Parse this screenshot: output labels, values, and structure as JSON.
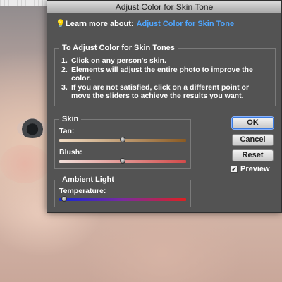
{
  "window": {
    "title": "Adjust Color for Skin Tone"
  },
  "learn_more": {
    "prefix": "Learn more about:",
    "link": "Adjust Color for Skin Tone",
    "icon": "lightbulb-icon"
  },
  "instructions": {
    "legend": "To Adjust Color for Skin Tones",
    "items": [
      {
        "num": "1.",
        "text": "Click on any person's skin."
      },
      {
        "num": "2.",
        "text": "Elements will adjust the entire photo to improve the color."
      },
      {
        "num": "3.",
        "text": "If you are not satisfied, click on a different point or move the sliders to achieve the results you want."
      }
    ]
  },
  "skin": {
    "legend": "Skin",
    "tan": {
      "label": "Tan:",
      "value_fraction": 0.5
    },
    "blush": {
      "label": "Blush:",
      "value_fraction": 0.5
    }
  },
  "ambient": {
    "legend": "Ambient Light",
    "temperature": {
      "label": "Temperature:",
      "value_fraction": 0.04
    }
  },
  "buttons": {
    "ok": "OK",
    "cancel": "Cancel",
    "reset": "Reset"
  },
  "preview": {
    "label": "Preview",
    "checked": true
  },
  "colors": {
    "dialog_bg": "#535353",
    "link": "#4fa6ff",
    "tan_start": "#f2dcc4",
    "tan_end": "#8a5a22",
    "blush_start": "#f1e0da",
    "blush_end": "#d24a4a",
    "temp_start": "#1326d6",
    "temp_end": "#e02020"
  }
}
